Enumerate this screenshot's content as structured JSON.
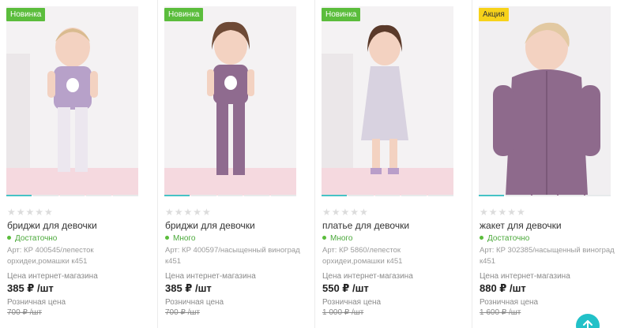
{
  "products": [
    {
      "badge": "Новинка",
      "badge_type": "new",
      "rating_stars": "★★★★★",
      "title": "бриджи для девочки",
      "stock": "Достаточно",
      "article": "Арт: КР 400545/лепесток орхидеи,ромашки к451",
      "price_label": "Цена интернет-магазина",
      "price": "385 ₽ /шт",
      "retail_label": "Розничная цена",
      "retail_price": "700 ₽ /шт",
      "garment_color": "#b7a1c9",
      "image_icon": "girl-in-top-and-leggings-photo"
    },
    {
      "badge": "Новинка",
      "badge_type": "new",
      "rating_stars": "★★★★★",
      "title": "бриджи для девочки",
      "stock": "Много",
      "article": "Арт: КР 400597/насыщенный виноград к451",
      "price_label": "Цена интернет-магазина",
      "price": "385 ₽ /шт",
      "retail_label": "Розничная цена",
      "retail_price": "700 ₽ /шт",
      "garment_color": "#8f6b8f",
      "image_icon": "girl-in-purple-set-photo"
    },
    {
      "badge": "Новинка",
      "badge_type": "new",
      "rating_stars": "★★★★★",
      "title": "платье для девочки",
      "stock": "Много",
      "article": "Арт: КР 5860/лепесток орхидеи,ромашки к451",
      "price_label": "Цена интернет-магазина",
      "price": "550 ₽ /шт",
      "retail_label": "Розничная цена",
      "retail_price": "1 000 ₽ /шт",
      "garment_color": "#d8d2e0",
      "image_icon": "girl-in-dress-photo"
    },
    {
      "badge": "Акция",
      "badge_type": "sale",
      "rating_stars": "★★★★★",
      "title": "жакет для девочки",
      "stock": "Достаточно",
      "article": "Арт: КР 302385/насыщенный виноград к451",
      "price_label": "Цена интернет-магазина",
      "price": "880 ₽ /шт",
      "retail_label": "Розничная цена",
      "retail_price": "1 600 ₽ /шт",
      "garment_color": "#8e6a8c",
      "image_icon": "girl-in-jacket-photo"
    }
  ],
  "colors": {
    "badge_new": "#5bbd3c",
    "badge_sale": "#f7d21a",
    "accent": "#22c1c8",
    "in_stock": "#4aa83a"
  },
  "scroll_top_icon": "arrow-up-icon"
}
